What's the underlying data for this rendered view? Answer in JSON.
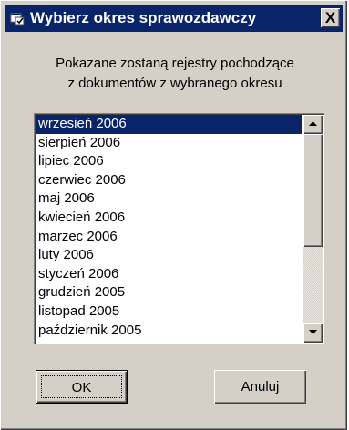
{
  "dialog": {
    "title": "Wybierz okres sprawozdawczy",
    "close_label": "X",
    "message_line1": "Pokazane zostaną rejestry pochodzące",
    "message_line2": "z dokumentów z wybranego okresu"
  },
  "periods": [
    "wrzesień 2006",
    "sierpień 2006",
    "lipiec 2006",
    "czerwiec 2006",
    "maj 2006",
    "kwiecień 2006",
    "marzec 2006",
    "luty 2006",
    "styczeń 2006",
    "grudzień 2005",
    "listopad 2005",
    "październik 2005"
  ],
  "selected_period": "wrzesień 2006",
  "buttons": {
    "ok_label": "OK",
    "cancel_label": "Anuluj"
  },
  "icons": {
    "title": "window-app-icon",
    "scroll_up": "triangle-up-icon",
    "scroll_down": "triangle-down-icon"
  },
  "colors": {
    "titlebar": "#0a246a",
    "selection": "#0a246a",
    "face": "#d4d0c8"
  }
}
